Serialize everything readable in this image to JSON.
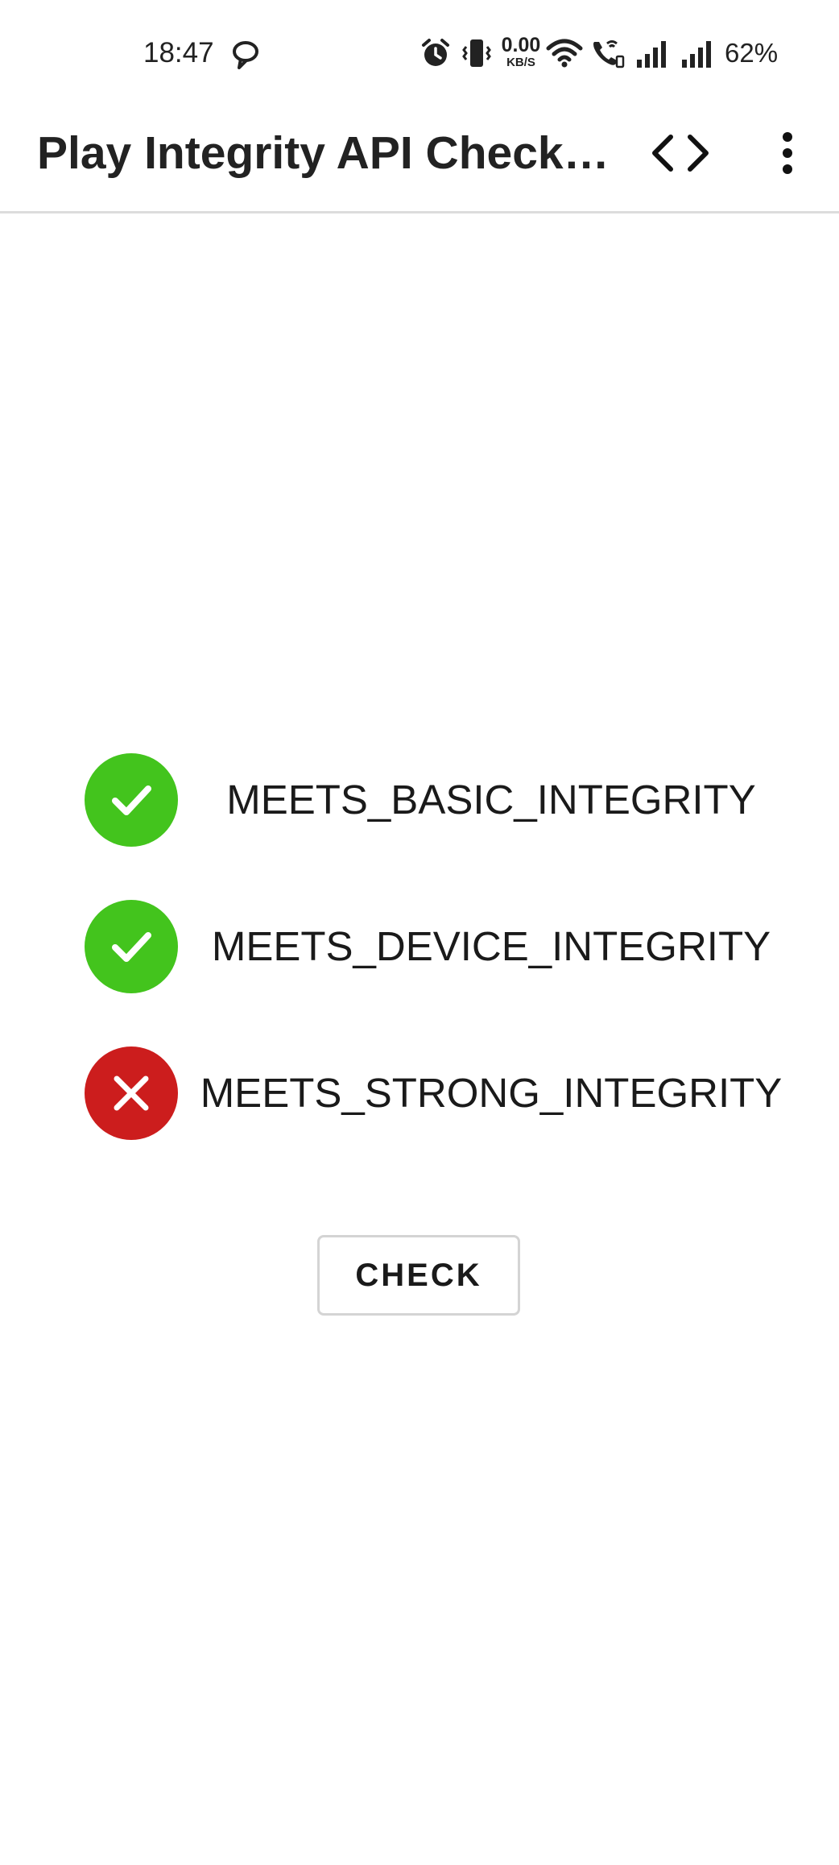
{
  "status_bar": {
    "time": "18:47",
    "net_speed_value": "0.00",
    "net_speed_unit": "KB/S",
    "battery": "62%",
    "icons": [
      "chat-bubble-icon",
      "alarm-icon",
      "vibrate-icon",
      "wifi-icon",
      "wifi-calling-icon",
      "signal-icon",
      "signal-icon"
    ]
  },
  "app_bar": {
    "title": "Play Integrity API Check…",
    "actions": [
      "code-icon",
      "more-vert-icon"
    ]
  },
  "integrity_checks": [
    {
      "label": "MEETS_BASIC_INTEGRITY",
      "passed": true,
      "icon": "check-circle-icon"
    },
    {
      "label": "MEETS_DEVICE_INTEGRITY",
      "passed": true,
      "icon": "check-circle-icon"
    },
    {
      "label": "MEETS_STRONG_INTEGRITY",
      "passed": false,
      "icon": "cross-circle-icon"
    }
  ],
  "check_button": {
    "label": "CHECK"
  },
  "colors": {
    "pass": "#43c41d",
    "fail": "#cc1d1d",
    "text": "#1a1a1a",
    "divider": "#dcdcdc"
  }
}
